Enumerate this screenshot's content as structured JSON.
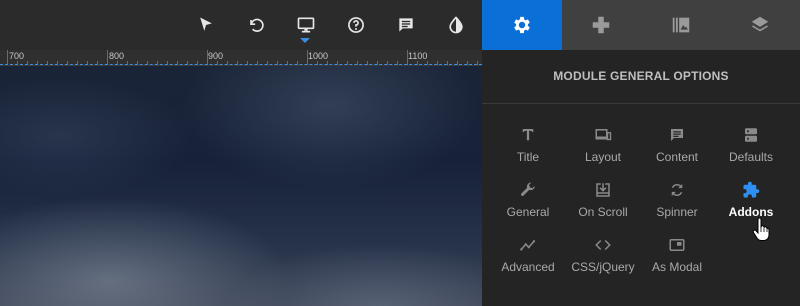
{
  "toolbar": {
    "icons": [
      "pointer-icon",
      "undo-icon",
      "desktop-icon",
      "help-icon",
      "comment-icon",
      "contrast-icon"
    ]
  },
  "ruler": {
    "labels": [
      "700",
      "800",
      "900",
      "1000",
      "1100"
    ]
  },
  "tabs": [
    {
      "icon": "gear-icon",
      "active": true
    },
    {
      "icon": "gamepad-icon",
      "active": false
    },
    {
      "icon": "library-icon",
      "active": false
    },
    {
      "icon": "layers-icon",
      "active": false
    }
  ],
  "panel": {
    "title": "MODULE GENERAL OPTIONS",
    "options": [
      {
        "label": "Title",
        "icon": "title-icon"
      },
      {
        "label": "Layout",
        "icon": "layout-icon"
      },
      {
        "label": "Content",
        "icon": "content-icon"
      },
      {
        "label": "Defaults",
        "icon": "defaults-icon"
      },
      {
        "label": "General",
        "icon": "wrench-icon"
      },
      {
        "label": "On Scroll",
        "icon": "on-scroll-icon"
      },
      {
        "label": "Spinner",
        "icon": "spinner-icon"
      },
      {
        "label": "Addons",
        "icon": "puzzle-icon",
        "active": true
      },
      {
        "label": "Advanced",
        "icon": "advanced-icon"
      },
      {
        "label": "CSS/jQuery",
        "icon": "code-icon"
      },
      {
        "label": "As Modal",
        "icon": "modal-icon"
      }
    ]
  },
  "colors": {
    "accent": "#0a6fd6",
    "panel_bg": "#242424",
    "label": "#a9a9a9",
    "active_icon": "#2e8ff0"
  }
}
